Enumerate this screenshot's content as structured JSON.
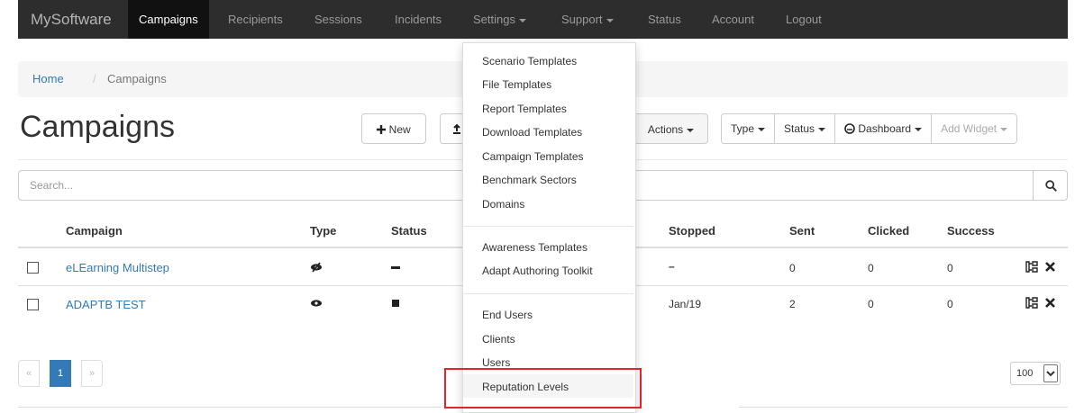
{
  "navbar": {
    "brand": "MySoftware",
    "items": [
      {
        "label": "Campaigns"
      },
      {
        "label": "Recipients"
      },
      {
        "label": "Sessions"
      },
      {
        "label": "Incidents"
      },
      {
        "label": "Settings"
      },
      {
        "label": "Support"
      },
      {
        "label": "Status"
      },
      {
        "label": "Account"
      },
      {
        "label": "Logout"
      }
    ]
  },
  "breadcrumb": {
    "home": "Home",
    "separator": "/",
    "current": "Campaigns"
  },
  "page": {
    "title": "Campaigns"
  },
  "toolbar": {
    "new_label": "New",
    "actions_label": "Actions",
    "type_label": "Type",
    "status_label": "Status",
    "dashboard_label": "Dashboard",
    "add_widget_label": "Add Widget"
  },
  "search": {
    "placeholder": "Search..."
  },
  "table": {
    "headers": {
      "campaign": "Campaign",
      "type": "Type",
      "status": "Status",
      "stopped": "Stopped",
      "sent": "Sent",
      "clicked": "Clicked",
      "success": "Success"
    },
    "rows": [
      {
        "campaign": "eLEarning Multistep",
        "type_icon": "eye-slash-icon",
        "status_icon": "dash-icon",
        "stopped": "–",
        "sent": "0",
        "clicked": "0",
        "success": "0"
      },
      {
        "campaign": "ADAPTB TEST",
        "type_icon": "eye-icon",
        "status_icon": "stop-square-icon",
        "stopped": "Jan/19",
        "sent": "2",
        "clicked": "0",
        "success": "0"
      }
    ]
  },
  "pagination": {
    "prev": "«",
    "current": "1",
    "next": "»",
    "page_size": "100"
  },
  "settings_menu": {
    "groups": [
      [
        "Scenario Templates",
        "File Templates",
        "Report Templates",
        "Download Templates",
        "Campaign Templates",
        "Benchmark Sectors",
        "Domains"
      ],
      [
        "Awareness Templates",
        "Adapt Authoring Toolkit"
      ],
      [
        "End Users",
        "Clients",
        "Users",
        "Reputation Levels"
      ]
    ],
    "highlighted": "Reputation Levels"
  },
  "colors": {
    "navbar": "#2d2d2d",
    "link": "#337ab7",
    "highlight_box": "#e3242b"
  }
}
